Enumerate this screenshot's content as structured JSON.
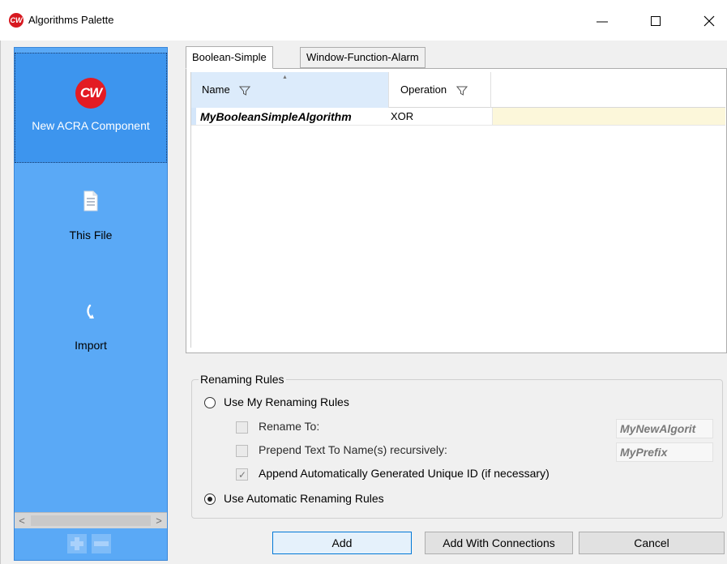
{
  "window": {
    "title": "Algorithms Palette",
    "icon_text": "CW"
  },
  "sidebar": {
    "items": [
      {
        "label": "New ACRA Component",
        "icon": "cw-logo-icon",
        "icon_text": "CW"
      },
      {
        "label": "This File",
        "icon": "document-icon"
      },
      {
        "label": "Import",
        "icon": "import-arrow-icon"
      }
    ],
    "scroll_left": "<",
    "scroll_right": ">"
  },
  "tabs": [
    {
      "label": "Boolean-Simple",
      "active": true
    },
    {
      "label": "Window-Function-Alarm",
      "active": false
    }
  ],
  "grid": {
    "columns": [
      "Name",
      "Operation"
    ],
    "rows": [
      {
        "name": "MyBooleanSimpleAlgorithm",
        "operation": "XOR"
      }
    ]
  },
  "renaming": {
    "title": "Renaming Rules",
    "use_my_rules": "Use My Renaming Rules",
    "rename_to_label": "Rename To:",
    "rename_to_value": "MyNewAlgorit",
    "prepend_label": "Prepend Text To Name(s) recursively:",
    "prepend_value": "MyPrefix",
    "append_label": "Append Automatically Generated Unique ID (if necessary)",
    "use_automatic": "Use Automatic Renaming Rules"
  },
  "buttons": {
    "add": "Add",
    "add_with_connections": "Add With Connections",
    "cancel": "Cancel"
  },
  "colors": {
    "sidebar": "#5aa9f6",
    "brand_red": "#e31b23",
    "row_highlight": "#fcf7da"
  }
}
